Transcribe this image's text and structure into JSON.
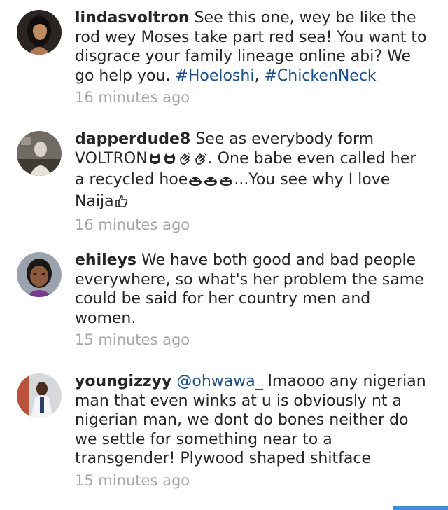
{
  "comments": [
    {
      "username": "lindasvoltron",
      "text": "See this one, wey be like the rod wey Moses take part red sea! You want to disgrace your family lineage online abi? We go help you.",
      "hashtags": [
        "#Hoeloshi",
        "#ChickenNeck"
      ],
      "hashtag_separator": ",",
      "timestamp": "16 minutes ago"
    },
    {
      "username": "dapperdude8",
      "text_1": "See as everybody form VOLTRON",
      "text_2": ". One babe even called her a recycled hoe",
      "text_3": "...You see why I love Naija",
      "emoji": {
        "part_1": [
          "laughing-cat-icon",
          "laughing-cat-icon",
          "clapping-hands-icon",
          "clapping-hands-icon"
        ],
        "part_2": [
          "laughing-face-icon",
          "laughing-face-icon",
          "laughing-face-icon"
        ],
        "part_3": [
          "thumbs-up-icon"
        ]
      },
      "timestamp": "16 minutes ago"
    },
    {
      "username": "ehileys",
      "text": "We have both good and bad people everywhere, so what's her problem the same could be said for her country men and women.",
      "timestamp": "15 minutes ago"
    },
    {
      "username": "youngizzyy",
      "mention": "@ohwawa_",
      "text": "lmaooo any nigerian man that even winks at u is obviously nt a nigerian man, we dont do bones neither do we settle for something near to a transgender! Plywood shaped shitface",
      "timestamp": "15 minutes ago"
    }
  ],
  "colors": {
    "text": "#262626",
    "link": "#1b4f8a",
    "timestamp": "#a6a6a6",
    "scroll_indicator": "#3d8fd6"
  }
}
